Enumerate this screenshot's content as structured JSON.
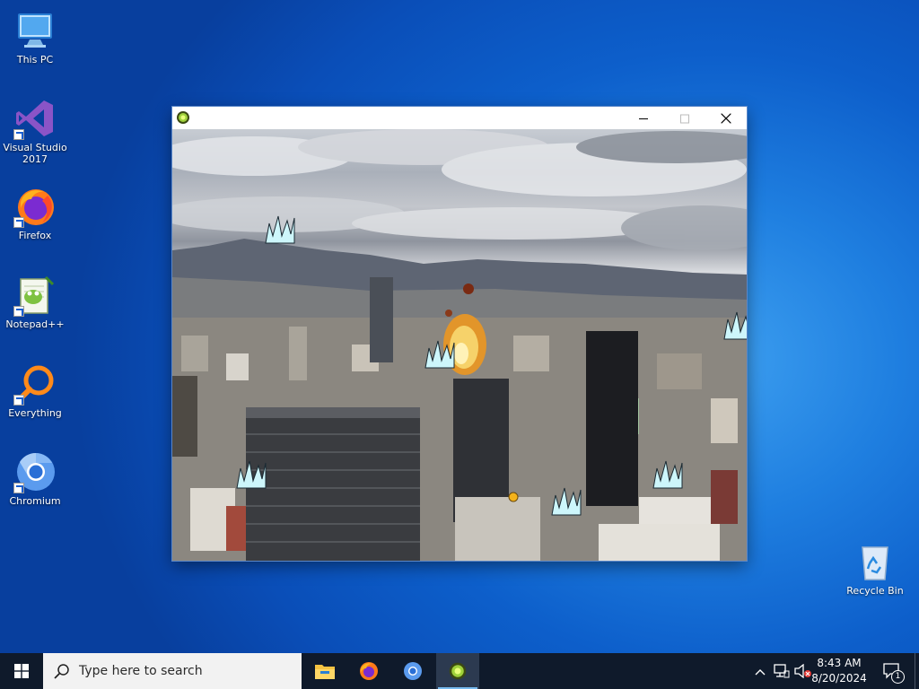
{
  "desktop": {
    "icons": [
      {
        "label": "This PC",
        "icon": "this-pc-icon"
      },
      {
        "label": "Visual Studio 2017",
        "icon": "visual-studio-icon"
      },
      {
        "label": "Firefox",
        "icon": "firefox-icon"
      },
      {
        "label": "Notepad++",
        "icon": "notepadpp-icon"
      },
      {
        "label": "Everything",
        "icon": "everything-icon"
      },
      {
        "label": "Chromium",
        "icon": "chromium-icon"
      },
      {
        "label": "Recycle Bin",
        "icon": "recycle-bin-icon"
      }
    ]
  },
  "window": {
    "title": "",
    "icon": "game-app-icon"
  },
  "taskbar": {
    "search_placeholder": "Type here to search",
    "apps": [
      "file-explorer-icon",
      "firefox-icon",
      "chromium-icon",
      "game-app-icon"
    ],
    "clock_time": "8:43 AM",
    "clock_date": "8/20/2024",
    "notification_count": "1"
  },
  "colors": {
    "desktop_blue": "#0d5fcb",
    "taskbar": "#0f1a2b",
    "enemy_ice": "#cdf6fb",
    "accent": "#76b9ed"
  }
}
